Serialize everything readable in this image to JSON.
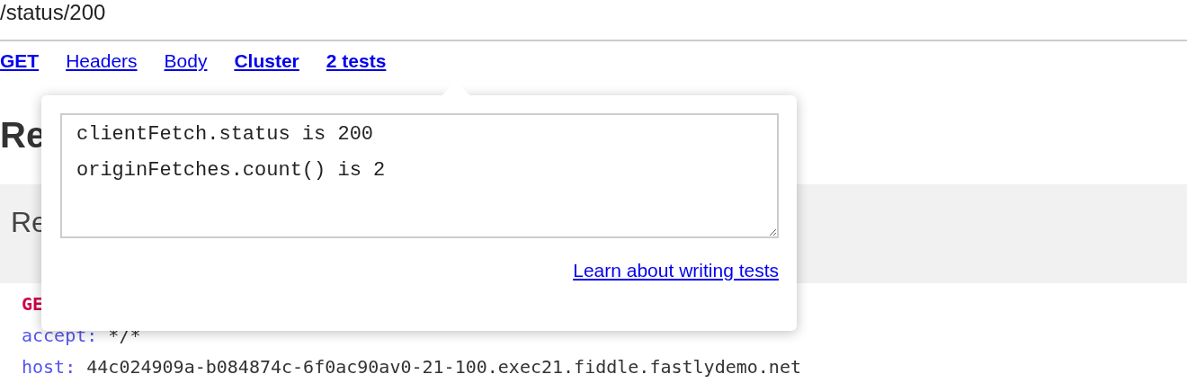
{
  "path": "/status/200",
  "nav": [
    {
      "label": "GET",
      "kind": "bold"
    },
    {
      "label": "Headers",
      "kind": "plain"
    },
    {
      "label": "Body",
      "kind": "plain"
    },
    {
      "label": "Cluster",
      "kind": "bold"
    },
    {
      "label": "2 tests",
      "kind": "bold"
    }
  ],
  "heading": "Re",
  "section": {
    "heading": "Re",
    "request": {
      "method": "GE",
      "headers": [
        {
          "name": "accept:",
          "value": "*/*"
        },
        {
          "name": "host:",
          "value": "44c024909a-b084874c-6f0ac90av0-21-100.exec21.fiddle.fastlydemo.net"
        }
      ]
    }
  },
  "popover": {
    "tests": "clientFetch.status is 200\noriginFetches.count() is 2",
    "link": "Learn about writing tests"
  }
}
